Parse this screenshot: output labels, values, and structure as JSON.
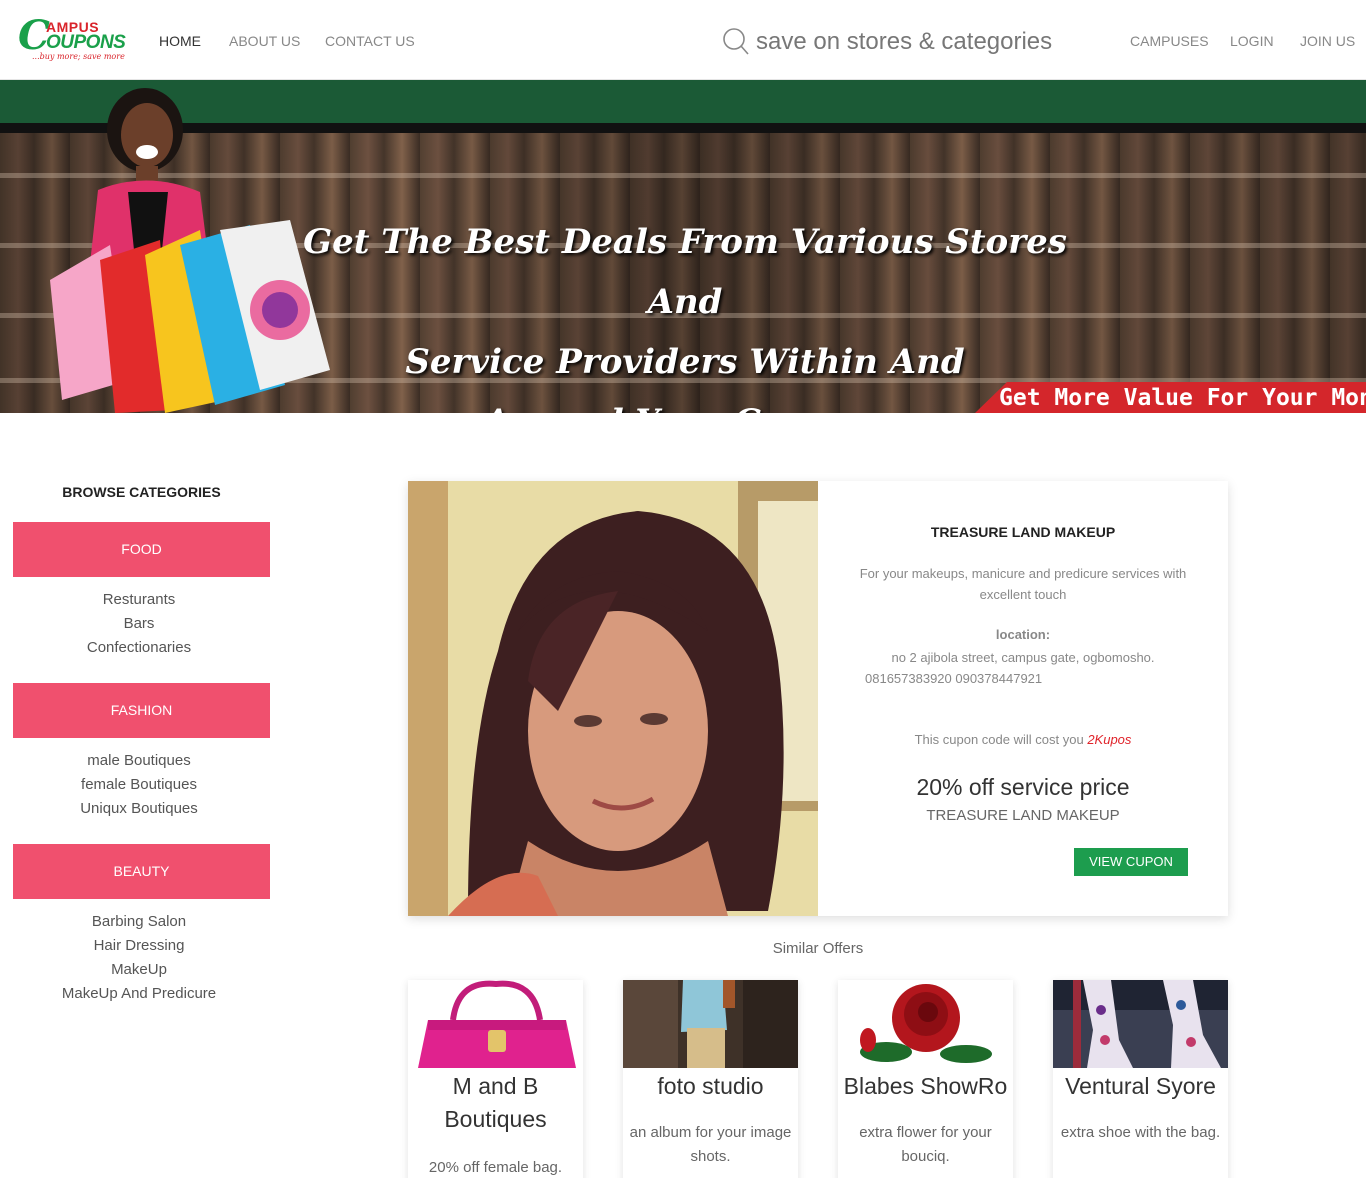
{
  "brand": {
    "logo_c": "C",
    "logo_ampus": "AMPUS",
    "logo_oupons": "OUPONS",
    "tagline": "...buy more; save more",
    "green": "#1aa04a",
    "red": "#d9242b"
  },
  "nav": {
    "home": "HOME",
    "about": "ABOUT US",
    "contact": "CONTACT US",
    "campuses": "CAMPUSES",
    "login": "LOGIN",
    "join": "JOIN US"
  },
  "search": {
    "placeholder": "save on stores & categories",
    "icon": "search-icon"
  },
  "hero": {
    "headline_line1": "Get The Best Deals From Various Stores And",
    "headline_line2": "Service Providers Within And",
    "headline_line3": "Around Your Campus",
    "ribbon": "Get More Value For Your Money"
  },
  "sidebar": {
    "title": "BROWSE CATEGORIES",
    "categories": [
      {
        "label": "FOOD",
        "items": [
          "Resturants",
          "Bars",
          "Confectionaries"
        ]
      },
      {
        "label": "FASHION",
        "items": [
          "male Boutiques",
          "female Boutiques",
          "Uniqux Boutiques"
        ]
      },
      {
        "label": "BEAUTY",
        "items": [
          "Barbing Salon",
          "Hair Dressing",
          "MakeUp",
          "MakeUp And Predicure"
        ]
      }
    ],
    "button_color": "#f0506e"
  },
  "featured": {
    "title": "TREASURE LAND MAKEUP",
    "description": "For your makeups, manicure and predicure services with excellent touch",
    "location_label": "location:",
    "location": "no 2 ajibola street, campus gate, ogbomosho.",
    "phones": "081657383920 090378447921",
    "cost_prefix": "This cupon code will cost you",
    "cost_value": "2Kupos",
    "offer": "20% off service price",
    "store": "TREASURE LAND MAKEUP",
    "button": "VIEW CUPON",
    "button_color": "#1d9d4e"
  },
  "similar": {
    "title": "Similar Offers",
    "offers": [
      {
        "title": "M and B Boutiques",
        "description": "20% off female bag."
      },
      {
        "title": "foto studio",
        "description": "an album for your image shots."
      },
      {
        "title": "Blabes ShowRo",
        "description": "extra flower for your bouciq."
      },
      {
        "title": "Ventural Syore",
        "description": "extra shoe with the bag."
      }
    ]
  }
}
